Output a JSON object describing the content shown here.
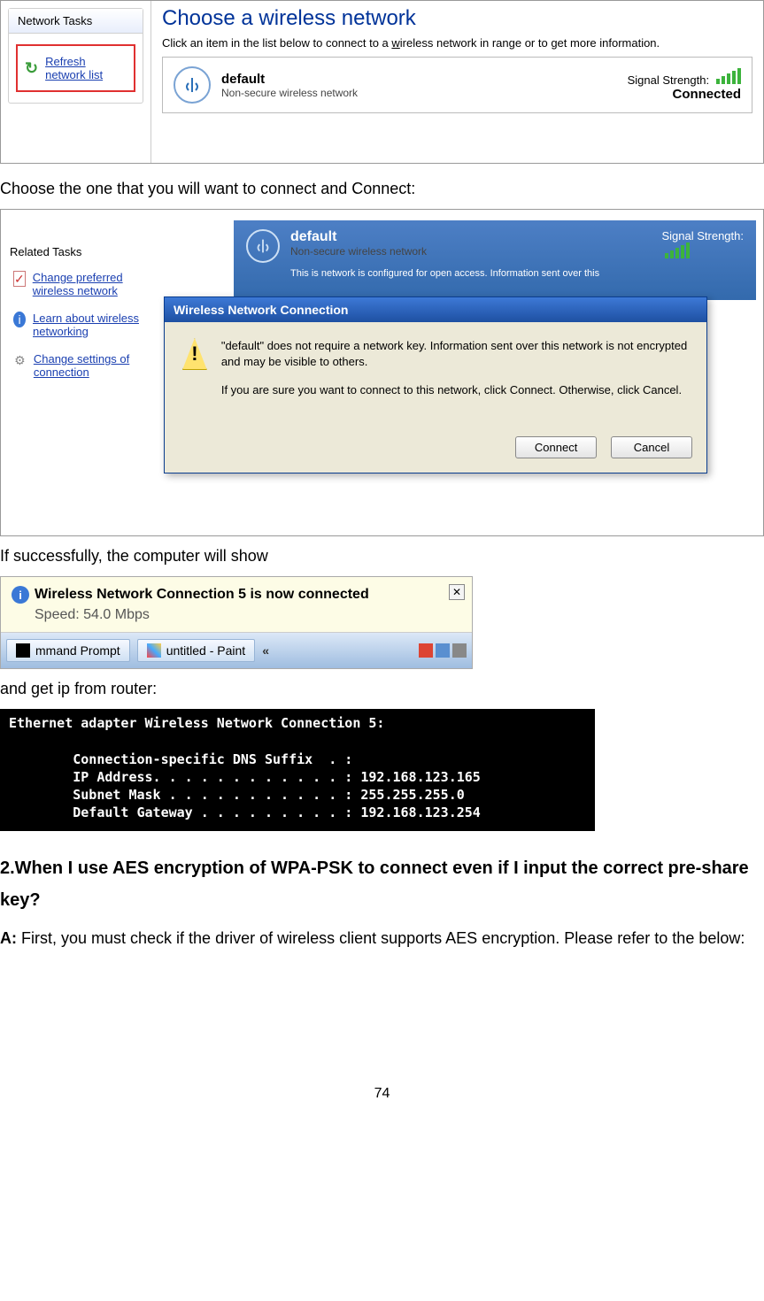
{
  "shot1": {
    "tasks_header": "Network Tasks",
    "refresh_label": "Refresh\nnetwork list",
    "choose_title": "Choose a wireless network",
    "choose_desc_pre": "Click an item in the list below to connect to a ",
    "choose_desc_u": "w",
    "choose_desc_post": "ireless network in range or to get more information.",
    "net_name": "default",
    "net_sub": "Non-secure wireless network",
    "sig_label": "Signal Strength:",
    "connected": "Connected"
  },
  "text1": "Choose the one that you will want to connect and Connect:",
  "shot2": {
    "related_header": "Related Tasks",
    "link1": "Change preferred wireless network",
    "link2": "Learn about wireless networking",
    "link3": "Change settings of connection",
    "netbar_name": "default",
    "netbar_sub": "Non-secure wireless network",
    "netbar_info": "This is network is configured for open access. Information sent over this",
    "sig_label": "Signal Strength:",
    "dialog_title": "Wireless Network Connection",
    "dialog_p1": "\"default\" does not require a network key. Information sent over this network is not encrypted and may be visible to others.",
    "dialog_p2": "If you are sure you want to connect to this network, click Connect. Otherwise, click Cancel.",
    "btn_connect": "Connect",
    "btn_cancel": "Cancel"
  },
  "text2": "If successfully, the computer will show",
  "shot3": {
    "balloon_title": "Wireless Network Connection 5 is now connected",
    "balloon_speed": "Speed: 54.0 Mbps",
    "task_cmd": "mmand Prompt",
    "task_paint": "untitled - Paint"
  },
  "text3": "and get ip from router:",
  "cmd": "Ethernet adapter Wireless Network Connection 5:\n\n        Connection-specific DNS Suffix  . :\n        IP Address. . . . . . . . . . . . : 192.168.123.165\n        Subnet Mask . . . . . . . . . . . : 255.255.255.0\n        Default Gateway . . . . . . . . . : 192.168.123.254",
  "q2": {
    "title": "2.When I use AES encryption of WPA-PSK to connect even if I input the correct pre-share key?",
    "a_label": "A:",
    "a_text": " First, you must check if the driver of wireless client supports AES encryption. Please refer to the below:"
  },
  "page_num": "74"
}
